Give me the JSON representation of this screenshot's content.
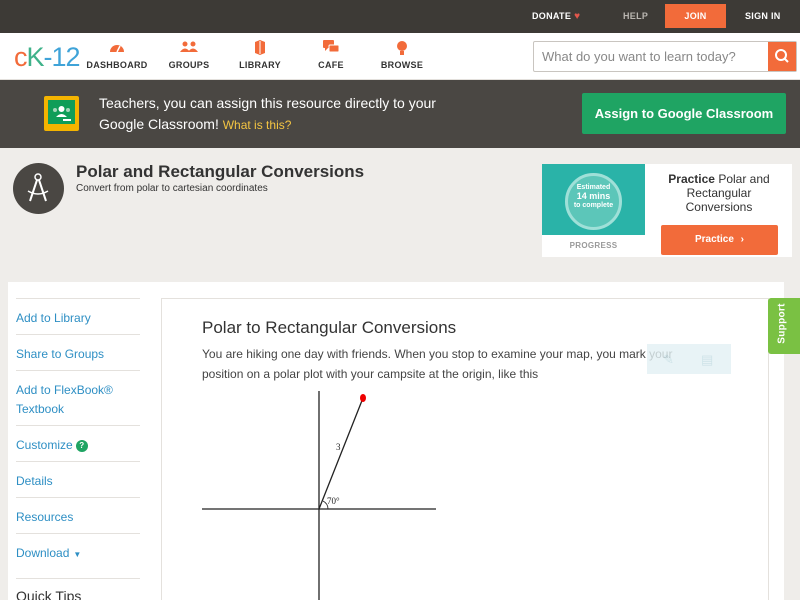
{
  "topbar": {
    "donate": "DONATE",
    "help": "HELP",
    "join": "JOIN",
    "sign_in": "SIGN IN"
  },
  "nav": {
    "logo": {
      "c": "c",
      "k": "K",
      "n": "-12"
    },
    "items": [
      {
        "label": "DASHBOARD",
        "icon": "dashboard-icon"
      },
      {
        "label": "GROUPS",
        "icon": "groups-icon"
      },
      {
        "label": "LIBRARY",
        "icon": "library-icon"
      },
      {
        "label": "CAFE",
        "icon": "cafe-icon"
      },
      {
        "label": "BROWSE",
        "icon": "browse-icon"
      }
    ],
    "search_placeholder": "What do you want to learn today?"
  },
  "banner": {
    "text": "Teachers, you can assign this resource directly to your Google Classroom!",
    "what_is_this": "What is this?",
    "assign_button": "Assign to Google Classroom"
  },
  "concept": {
    "title": "Polar and Rectangular Conversions",
    "subtitle": "Convert from polar to cartesian coordinates"
  },
  "practice": {
    "estimated": "Estimated",
    "minutes": "14 mins",
    "to_complete": "to complete",
    "progress": "PROGRESS",
    "title_bold": "Practice",
    "title_rest": "Polar and Rectangular Conversions",
    "button": "Practice"
  },
  "sidebar": {
    "items": [
      {
        "label": "Add to Library"
      },
      {
        "label": "Share to Groups"
      },
      {
        "label": "Add to FlexBook® Textbook"
      },
      {
        "label": "Customize"
      },
      {
        "label": "Details"
      },
      {
        "label": "Resources"
      },
      {
        "label": "Download"
      }
    ],
    "quick_tips": "Quick Tips"
  },
  "content": {
    "heading": "Polar to Rectangular Conversions",
    "paragraph": "You are hiking one day with friends. When you stop to examine your map, you mark your position on a polar plot with your campsite at the origin, like this",
    "plot": {
      "radius_label": "3",
      "angle_label": "70°"
    }
  },
  "support_tab": "Support",
  "colors": {
    "brand_orange": "#f26b3a",
    "google_green": "#1fa463",
    "link_blue": "#2e8fc4",
    "support_green": "#7ac143"
  }
}
